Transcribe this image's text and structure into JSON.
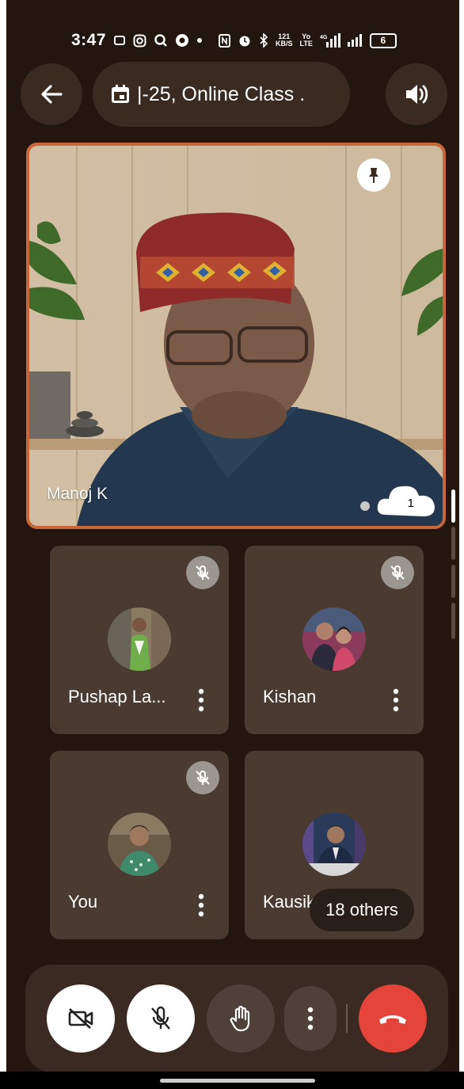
{
  "status_bar": {
    "time": "3:47",
    "net_speed_value": "121",
    "net_speed_unit": "KB/S",
    "volte_top": "Yo",
    "volte_bottom": "LTE",
    "network": "⁴⁵",
    "battery": "6"
  },
  "top_bar": {
    "meeting_title": "|-25,  Online Class ."
  },
  "main_video": {
    "speaker_name": "Manoj K",
    "reaction_count": "1"
  },
  "participants": [
    {
      "name": "Pushap La...",
      "muted": true
    },
    {
      "name": "Kishan",
      "muted": true
    },
    {
      "name": "You",
      "muted": true
    },
    {
      "name": "Kausik",
      "muted": false
    }
  ],
  "others_badge": "18 others",
  "colors": {
    "background": "#22160f",
    "tile": "#4a3a30",
    "active_border": "#c8663a",
    "end_call": "#e5443a",
    "control_bar": "#3b2a21"
  }
}
